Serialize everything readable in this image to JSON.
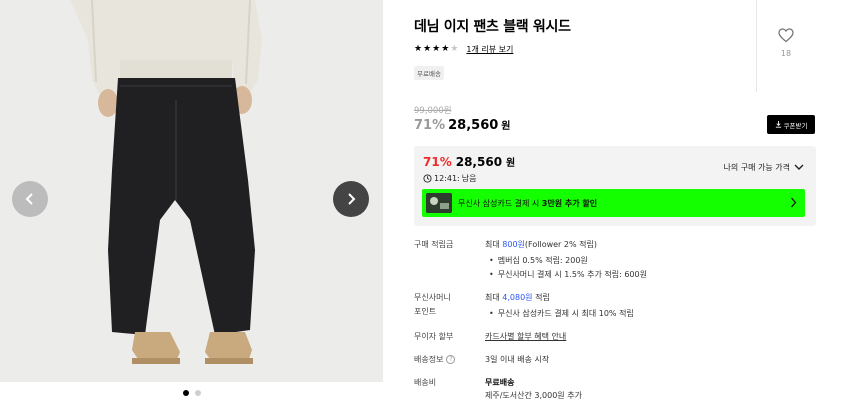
{
  "product": {
    "title": "데님 이지 팬츠 블랙 워시드",
    "rating_stars": 4,
    "rating_max": 5,
    "review_link": "1개 리뷰 보기",
    "shipping_badge": "무료배송",
    "like_count": "18",
    "original_price": "99,000원",
    "discount_pct": "71%",
    "sale_price": "28,560",
    "won": "원",
    "coupon_label": "쿠폰받기"
  },
  "price_box": {
    "discount_pct": "71%",
    "price": "28,560",
    "won": "원",
    "lowest_label": "나의 구매 가능 가격",
    "timer": "12:41:",
    "timer_suffix": "남음",
    "card_text_pre": "무신사 삼성카드 결제 시",
    "card_text_bold": "3만원 추가 할인"
  },
  "details": {
    "points_label": "구매 적립금",
    "points_pre": "최대",
    "points_amount": "800원",
    "points_post": "(Follower 2% 적립)",
    "points_sub1": "멤버십 0.5% 적립: 200원",
    "points_sub2": "무신사머니 결제 시 1.5% 추가 적립: 600원",
    "money_label_1": "무신사머니",
    "money_label_2": "포인트",
    "money_pre": "최대",
    "money_amount": "4,080원",
    "money_post": "적립",
    "money_sub1": "무신사 삼성카드 결제 시 최대 10% 적립",
    "installment_label": "무이자 할부",
    "installment_link": "카드사별 할부 혜택 안내",
    "delivery_label": "배송정보",
    "delivery_help": "?",
    "delivery_value": "3일 이내 배송 시작",
    "fee_label": "배송비",
    "fee_value": "무료배송",
    "fee_sub": "제주/도서산간 3,000원 추가"
  },
  "gallery": {
    "slide_count": 2,
    "active_slide": 1
  },
  "colors": {
    "accent_red": "#f02b2b",
    "accent_blue": "#2a56f6",
    "card_banner": "#14ff00"
  }
}
